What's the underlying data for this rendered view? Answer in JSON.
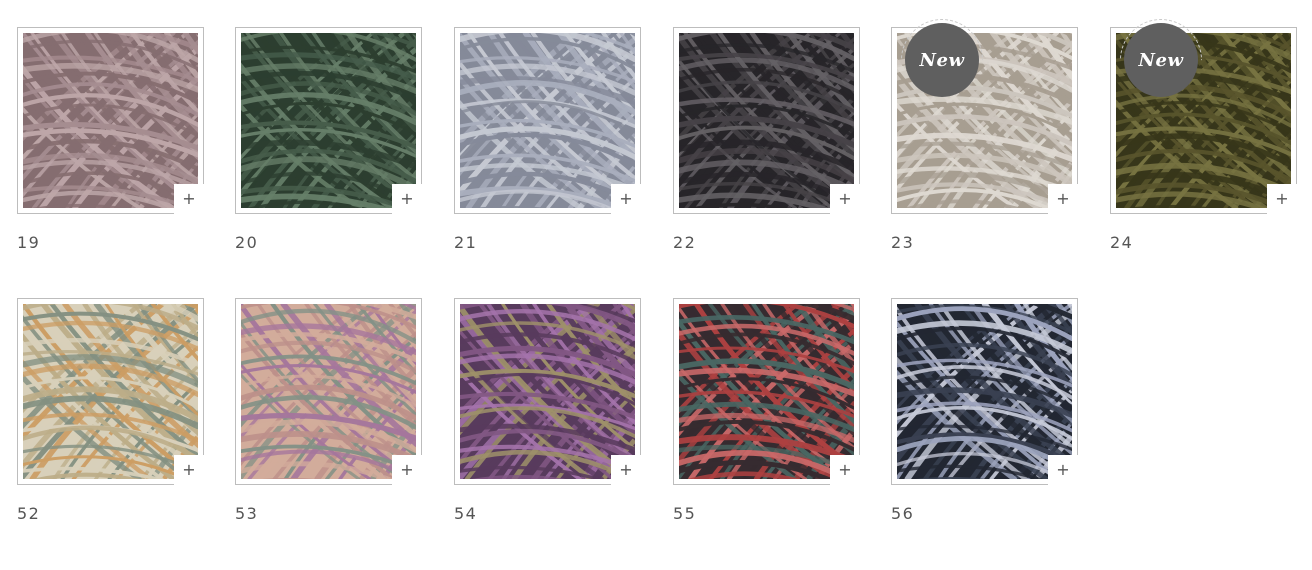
{
  "swatches": [
    {
      "label": "19",
      "badge": "",
      "colors": [
        "#b0969a",
        "#c9b1b3",
        "#8e7477"
      ]
    },
    {
      "label": "20",
      "badge": "",
      "colors": [
        "#4b6350",
        "#6d8770",
        "#2f4233"
      ]
    },
    {
      "label": "21",
      "badge": "",
      "colors": [
        "#b4b9c9",
        "#d2d6e0",
        "#8e93a3"
      ]
    },
    {
      "label": "22",
      "badge": "",
      "colors": [
        "#4b474c",
        "#6b676c",
        "#2a282c"
      ]
    },
    {
      "label": "23",
      "badge": "New",
      "colors": [
        "#d9d2c9",
        "#ece7df",
        "#b2a89b"
      ]
    },
    {
      "label": "24",
      "badge": "New",
      "colors": [
        "#5e5a2f",
        "#7f7b46",
        "#3b3a1c"
      ]
    },
    {
      "label": "52",
      "badge": "",
      "colors": [
        "#c8b891",
        "#8c9a8a",
        "#d9a76a",
        "#e6ddc6"
      ]
    },
    {
      "label": "53",
      "badge": "",
      "colors": [
        "#c99a93",
        "#8c9b8f",
        "#b07ea6",
        "#e0b7a5"
      ]
    },
    {
      "label": "54",
      "badge": "",
      "colors": [
        "#8a5d8c",
        "#b07bb7",
        "#a89a70",
        "#5e3f63"
      ]
    },
    {
      "label": "55",
      "badge": "",
      "colors": [
        "#b84545",
        "#4e6e6a",
        "#d77070",
        "#3a2e33"
      ]
    },
    {
      "label": "56",
      "badge": "",
      "colors": [
        "#3e4658",
        "#a6aec9",
        "#d3d7e6",
        "#252a36"
      ]
    }
  ],
  "expand_symbol": "+"
}
